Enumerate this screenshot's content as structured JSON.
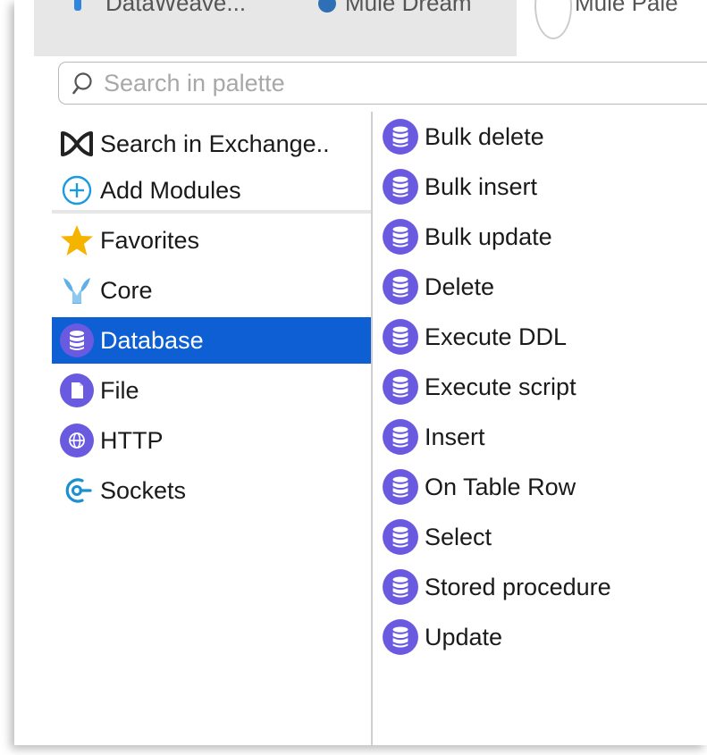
{
  "tabs": [
    {
      "label": "DataWeave..."
    },
    {
      "label": "Mule Dream"
    },
    {
      "label": "Mule Pale"
    }
  ],
  "search": {
    "placeholder": "Search in palette",
    "value": ""
  },
  "left_items": [
    {
      "label": "Search in Exchange..",
      "icon": "exchange-icon"
    },
    {
      "label": "Add Modules",
      "icon": "plus-circle-icon"
    },
    {
      "label": "Favorites",
      "icon": "star-icon"
    },
    {
      "label": "Core",
      "icon": "mule-core-icon"
    },
    {
      "label": "Database",
      "icon": "database-icon",
      "selected": true
    },
    {
      "label": "File",
      "icon": "file-icon"
    },
    {
      "label": "HTTP",
      "icon": "globe-icon"
    },
    {
      "label": "Sockets",
      "icon": "sockets-icon"
    }
  ],
  "operations": [
    {
      "label": "Bulk delete"
    },
    {
      "label": "Bulk insert"
    },
    {
      "label": "Bulk update"
    },
    {
      "label": "Delete"
    },
    {
      "label": "Execute DDL"
    },
    {
      "label": "Execute script"
    },
    {
      "label": "Insert"
    },
    {
      "label": "On Table Row"
    },
    {
      "label": "Select"
    },
    {
      "label": "Stored procedure"
    },
    {
      "label": "Update"
    }
  ],
  "colors": {
    "selection": "#0d5fd3",
    "module_icon": "#6a5ae0",
    "favorite_star": "#f5b400",
    "exchange_plus": "#1b9ae0",
    "sockets": "#1a8fd1"
  }
}
